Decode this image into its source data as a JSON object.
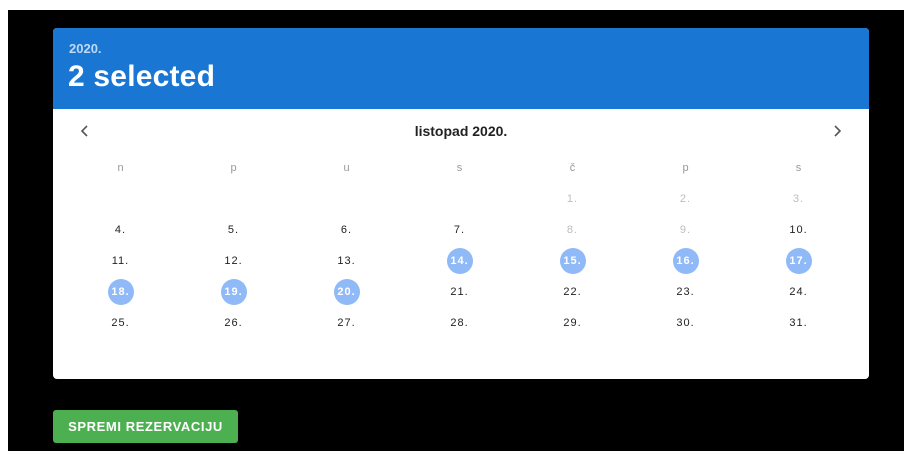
{
  "header": {
    "year": "2020.",
    "title": "2 selected",
    "background": "#1976d2"
  },
  "nav": {
    "month_label": "listopad 2020.",
    "prev_icon": "chevron-left-icon",
    "next_icon": "chevron-right-icon"
  },
  "weekdays": [
    "n",
    "p",
    "u",
    "s",
    "č",
    "p",
    "s"
  ],
  "weeks": [
    [
      {
        "label": "",
        "state": "empty"
      },
      {
        "label": "",
        "state": "empty"
      },
      {
        "label": "",
        "state": "empty"
      },
      {
        "label": "",
        "state": "empty"
      },
      {
        "label": "1.",
        "state": "disabled"
      },
      {
        "label": "2.",
        "state": "disabled"
      },
      {
        "label": "3.",
        "state": "disabled"
      }
    ],
    [
      {
        "label": "4.",
        "state": "normal"
      },
      {
        "label": "5.",
        "state": "normal"
      },
      {
        "label": "6.",
        "state": "normal"
      },
      {
        "label": "7.",
        "state": "normal"
      },
      {
        "label": "8.",
        "state": "disabled"
      },
      {
        "label": "9.",
        "state": "disabled"
      },
      {
        "label": "10.",
        "state": "normal"
      }
    ],
    [
      {
        "label": "11.",
        "state": "normal"
      },
      {
        "label": "12.",
        "state": "normal"
      },
      {
        "label": "13.",
        "state": "normal"
      },
      {
        "label": "14.",
        "state": "selected"
      },
      {
        "label": "15.",
        "state": "selected"
      },
      {
        "label": "16.",
        "state": "selected"
      },
      {
        "label": "17.",
        "state": "selected"
      }
    ],
    [
      {
        "label": "18.",
        "state": "selected"
      },
      {
        "label": "19.",
        "state": "selected"
      },
      {
        "label": "20.",
        "state": "selected"
      },
      {
        "label": "21.",
        "state": "normal"
      },
      {
        "label": "22.",
        "state": "normal"
      },
      {
        "label": "23.",
        "state": "normal"
      },
      {
        "label": "24.",
        "state": "normal"
      }
    ],
    [
      {
        "label": "25.",
        "state": "normal"
      },
      {
        "label": "26.",
        "state": "normal"
      },
      {
        "label": "27.",
        "state": "normal"
      },
      {
        "label": "28.",
        "state": "normal"
      },
      {
        "label": "29.",
        "state": "normal"
      },
      {
        "label": "30.",
        "state": "normal"
      },
      {
        "label": "31.",
        "state": "normal"
      }
    ]
  ],
  "actions": {
    "save_label": "SPREMI REZERVACIJU",
    "save_color": "#4caf50"
  },
  "colors": {
    "selected_day": "#90b9f7",
    "page_background": "#000000"
  }
}
